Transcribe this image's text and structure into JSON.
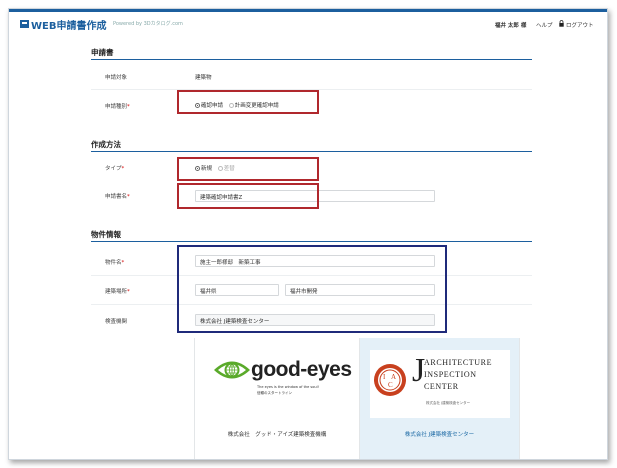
{
  "header": {
    "app_title": "WEB申請書作成",
    "powered_by": "Powered by 3Dカタログ.com",
    "user_name": "福井 太郎 様",
    "help": "ヘルプ",
    "logout": "ログアウト"
  },
  "sections": {
    "application": "申請書",
    "creation_method": "作成方法",
    "property_info": "物件情報"
  },
  "application": {
    "target_label": "申請対象",
    "target_value": "建築物",
    "type_label": "申請種別",
    "type_options": [
      "確認申請",
      "計画変更確認申請"
    ],
    "type_selected": "確認申請"
  },
  "creation": {
    "type_label": "タイプ",
    "type_options": [
      "新規",
      "差替"
    ],
    "type_selected": "新規",
    "name_label": "申請書名",
    "name_value": "建築確認申請書Z"
  },
  "property": {
    "name_label": "物件名",
    "name_value": "施主一郎様邸　新築工事",
    "location_label": "建築場所",
    "prefecture_value": "福井県",
    "city_value": "福井市開発",
    "agency_label": "検査機関",
    "agency_value": "株式会社 J建築検査センター"
  },
  "agencies": [
    {
      "logo_text": "good-eyes",
      "tagline_en": "The eyes is the window of the soul!",
      "tagline_jp": "信頼のスタートライン",
      "name": "株式会社　グッド・アイズ建築検査機構"
    },
    {
      "logo_letter": "J",
      "logo_lines": [
        "ARCHITECTURE",
        "INSPECTION",
        "CENTER"
      ],
      "logo_jp": "株式会社 J建築検査センター",
      "name": "株式会社 J建築検査センター"
    }
  ],
  "required_mark": "*",
  "colors": {
    "brand": "#1c5f9e",
    "highlight_red": "#b0282d",
    "highlight_blue": "#1f2a7a",
    "selected_card_bg": "#e4f0f8",
    "good_eyes_green": "#5aaa2a"
  }
}
